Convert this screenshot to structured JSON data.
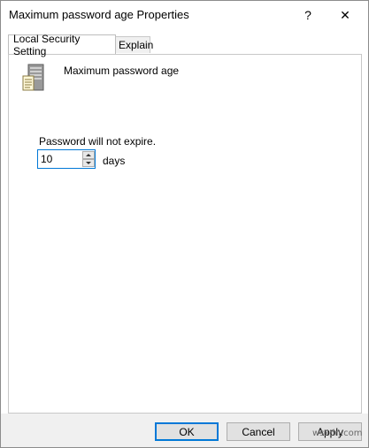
{
  "window": {
    "title": "Maximum password age Properties",
    "help_glyph": "?",
    "close_glyph": "✕"
  },
  "tabs": [
    {
      "label": "Local Security Setting",
      "active": true
    },
    {
      "label": "Explain",
      "active": false
    }
  ],
  "policy": {
    "icon": "server-icon",
    "name": "Maximum password age",
    "status_text": "Password will not expire.",
    "value": "10",
    "unit": "days"
  },
  "buttons": {
    "ok": "OK",
    "cancel": "Cancel",
    "apply": "Apply"
  },
  "watermark": "wsxdn.com",
  "colors": {
    "accent": "#0078d7",
    "footer_bg": "#f0f0f0",
    "button_bg": "#e1e1e1"
  }
}
